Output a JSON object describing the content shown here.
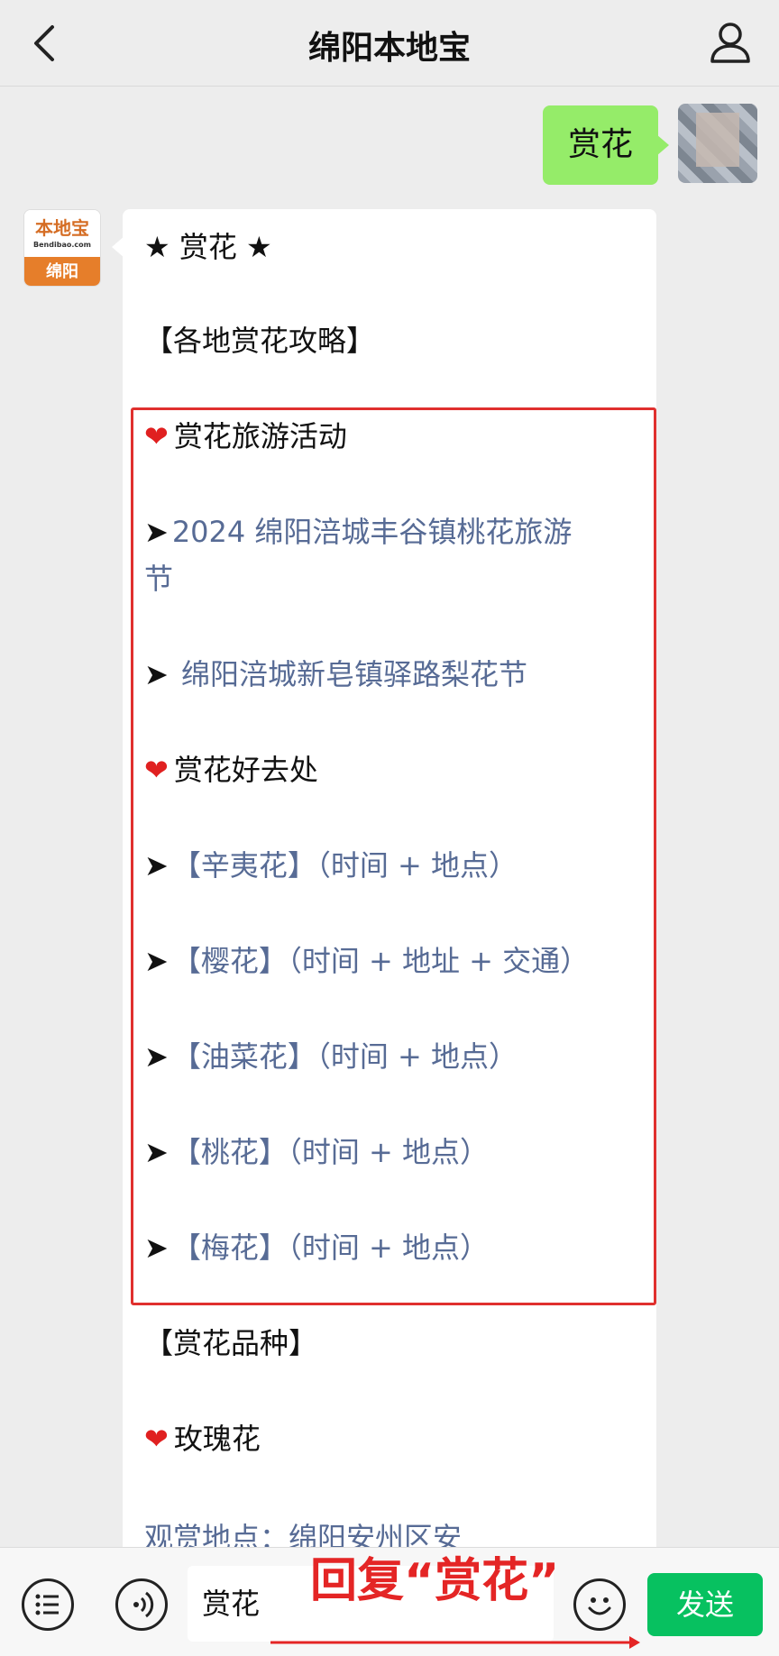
{
  "header": {
    "title": "绵阳本地宝",
    "back_icon": "chevron-left-icon",
    "profile_icon": "person-icon"
  },
  "user_message": {
    "text": "赏花"
  },
  "bot_avatar": {
    "brand": "本地宝",
    "domain": "Bendibao.com",
    "city": "绵阳"
  },
  "bot_message": {
    "title": "★ 赏花 ★",
    "section1": "【各地赏花攻略】",
    "activities_heading": "赏花旅游活动",
    "activities": [
      {
        "prefix": "➤",
        "text_line1": "2024 绵阳涪城丰谷镇桃花旅游",
        "text_line2": "节"
      },
      {
        "prefix": "➤",
        "text_line1": " 绵阳涪城新皂镇驿路梨花节"
      }
    ],
    "places_heading": "赏花好去处",
    "places": [
      {
        "prefix": "➤",
        "link": "【辛夷花】（时间 + 地点）"
      },
      {
        "prefix": "➤",
        "link": "【樱花】（时间 + 地址 + 交通）"
      },
      {
        "prefix": "➤",
        "link": "【油菜花】（时间 + 地点）"
      },
      {
        "prefix": "➤",
        "link": "【桃花】（时间 + 地点）"
      },
      {
        "prefix": "➤",
        "link": "【梅花】（时间 + 地点）"
      }
    ],
    "section2": "【赏花品种】",
    "variety_heading": "玫瑰花",
    "partial_text": "观赏地点：绵阳安州区安"
  },
  "input_bar": {
    "menu_icon": "list-icon",
    "voice_icon": "voice-icon",
    "input_value": "赏花",
    "emoji_icon": "smiley-icon",
    "send_label": "发送"
  },
  "annotation": {
    "text": "回复“赏花”"
  },
  "colors": {
    "background": "#ededed",
    "user_bubble": "#95ec69",
    "link": "#576b95",
    "send_button": "#07c160",
    "highlight": "#e0302e",
    "annotation": "#e42525"
  }
}
